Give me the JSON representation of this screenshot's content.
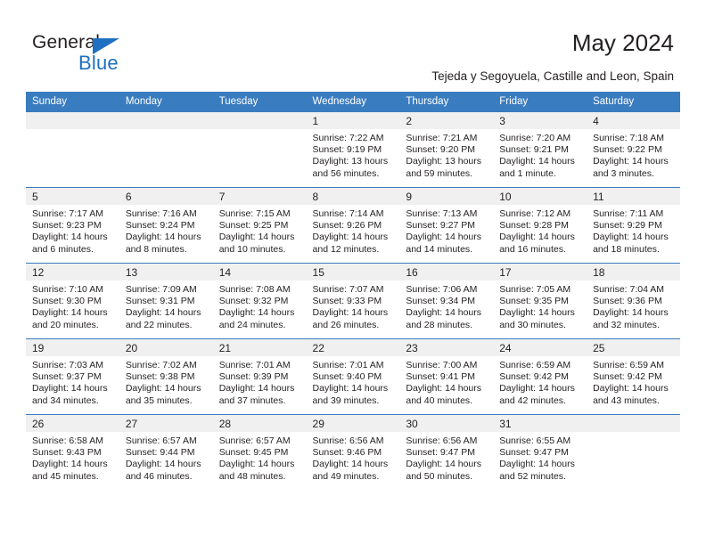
{
  "logo": {
    "word_one": "General",
    "word_two": "Blue",
    "triangle_color": "#1f70c1",
    "icon": "triangle-icon"
  },
  "header": {
    "title": "May 2024",
    "subtitle": "Tejeda y Segoyuela, Castille and Leon, Spain"
  },
  "colors": {
    "header_band": "#3a7cc0",
    "daynum_band": "#f0f0f0",
    "text": "#231f20",
    "brand_blue": "#1f70c1"
  },
  "calendar": {
    "weekday_headers": [
      "Sunday",
      "Monday",
      "Tuesday",
      "Wednesday",
      "Thursday",
      "Friday",
      "Saturday"
    ],
    "labels": {
      "sunrise": "Sunrise:",
      "sunset": "Sunset:",
      "daylight": "Daylight:"
    },
    "weeks": [
      [
        {
          "day": "",
          "empty": true
        },
        {
          "day": "",
          "empty": true
        },
        {
          "day": "",
          "empty": true
        },
        {
          "day": "1",
          "sunrise": "Sunrise: 7:22 AM",
          "sunset": "Sunset: 9:19 PM",
          "daylight": "Daylight: 13 hours and 56 minutes."
        },
        {
          "day": "2",
          "sunrise": "Sunrise: 7:21 AM",
          "sunset": "Sunset: 9:20 PM",
          "daylight": "Daylight: 13 hours and 59 minutes."
        },
        {
          "day": "3",
          "sunrise": "Sunrise: 7:20 AM",
          "sunset": "Sunset: 9:21 PM",
          "daylight": "Daylight: 14 hours and 1 minute."
        },
        {
          "day": "4",
          "sunrise": "Sunrise: 7:18 AM",
          "sunset": "Sunset: 9:22 PM",
          "daylight": "Daylight: 14 hours and 3 minutes."
        }
      ],
      [
        {
          "day": "5",
          "sunrise": "Sunrise: 7:17 AM",
          "sunset": "Sunset: 9:23 PM",
          "daylight": "Daylight: 14 hours and 6 minutes."
        },
        {
          "day": "6",
          "sunrise": "Sunrise: 7:16 AM",
          "sunset": "Sunset: 9:24 PM",
          "daylight": "Daylight: 14 hours and 8 minutes."
        },
        {
          "day": "7",
          "sunrise": "Sunrise: 7:15 AM",
          "sunset": "Sunset: 9:25 PM",
          "daylight": "Daylight: 14 hours and 10 minutes."
        },
        {
          "day": "8",
          "sunrise": "Sunrise: 7:14 AM",
          "sunset": "Sunset: 9:26 PM",
          "daylight": "Daylight: 14 hours and 12 minutes."
        },
        {
          "day": "9",
          "sunrise": "Sunrise: 7:13 AM",
          "sunset": "Sunset: 9:27 PM",
          "daylight": "Daylight: 14 hours and 14 minutes."
        },
        {
          "day": "10",
          "sunrise": "Sunrise: 7:12 AM",
          "sunset": "Sunset: 9:28 PM",
          "daylight": "Daylight: 14 hours and 16 minutes."
        },
        {
          "day": "11",
          "sunrise": "Sunrise: 7:11 AM",
          "sunset": "Sunset: 9:29 PM",
          "daylight": "Daylight: 14 hours and 18 minutes."
        }
      ],
      [
        {
          "day": "12",
          "sunrise": "Sunrise: 7:10 AM",
          "sunset": "Sunset: 9:30 PM",
          "daylight": "Daylight: 14 hours and 20 minutes."
        },
        {
          "day": "13",
          "sunrise": "Sunrise: 7:09 AM",
          "sunset": "Sunset: 9:31 PM",
          "daylight": "Daylight: 14 hours and 22 minutes."
        },
        {
          "day": "14",
          "sunrise": "Sunrise: 7:08 AM",
          "sunset": "Sunset: 9:32 PM",
          "daylight": "Daylight: 14 hours and 24 minutes."
        },
        {
          "day": "15",
          "sunrise": "Sunrise: 7:07 AM",
          "sunset": "Sunset: 9:33 PM",
          "daylight": "Daylight: 14 hours and 26 minutes."
        },
        {
          "day": "16",
          "sunrise": "Sunrise: 7:06 AM",
          "sunset": "Sunset: 9:34 PM",
          "daylight": "Daylight: 14 hours and 28 minutes."
        },
        {
          "day": "17",
          "sunrise": "Sunrise: 7:05 AM",
          "sunset": "Sunset: 9:35 PM",
          "daylight": "Daylight: 14 hours and 30 minutes."
        },
        {
          "day": "18",
          "sunrise": "Sunrise: 7:04 AM",
          "sunset": "Sunset: 9:36 PM",
          "daylight": "Daylight: 14 hours and 32 minutes."
        }
      ],
      [
        {
          "day": "19",
          "sunrise": "Sunrise: 7:03 AM",
          "sunset": "Sunset: 9:37 PM",
          "daylight": "Daylight: 14 hours and 34 minutes."
        },
        {
          "day": "20",
          "sunrise": "Sunrise: 7:02 AM",
          "sunset": "Sunset: 9:38 PM",
          "daylight": "Daylight: 14 hours and 35 minutes."
        },
        {
          "day": "21",
          "sunrise": "Sunrise: 7:01 AM",
          "sunset": "Sunset: 9:39 PM",
          "daylight": "Daylight: 14 hours and 37 minutes."
        },
        {
          "day": "22",
          "sunrise": "Sunrise: 7:01 AM",
          "sunset": "Sunset: 9:40 PM",
          "daylight": "Daylight: 14 hours and 39 minutes."
        },
        {
          "day": "23",
          "sunrise": "Sunrise: 7:00 AM",
          "sunset": "Sunset: 9:41 PM",
          "daylight": "Daylight: 14 hours and 40 minutes."
        },
        {
          "day": "24",
          "sunrise": "Sunrise: 6:59 AM",
          "sunset": "Sunset: 9:42 PM",
          "daylight": "Daylight: 14 hours and 42 minutes."
        },
        {
          "day": "25",
          "sunrise": "Sunrise: 6:59 AM",
          "sunset": "Sunset: 9:42 PM",
          "daylight": "Daylight: 14 hours and 43 minutes."
        }
      ],
      [
        {
          "day": "26",
          "sunrise": "Sunrise: 6:58 AM",
          "sunset": "Sunset: 9:43 PM",
          "daylight": "Daylight: 14 hours and 45 minutes."
        },
        {
          "day": "27",
          "sunrise": "Sunrise: 6:57 AM",
          "sunset": "Sunset: 9:44 PM",
          "daylight": "Daylight: 14 hours and 46 minutes."
        },
        {
          "day": "28",
          "sunrise": "Sunrise: 6:57 AM",
          "sunset": "Sunset: 9:45 PM",
          "daylight": "Daylight: 14 hours and 48 minutes."
        },
        {
          "day": "29",
          "sunrise": "Sunrise: 6:56 AM",
          "sunset": "Sunset: 9:46 PM",
          "daylight": "Daylight: 14 hours and 49 minutes."
        },
        {
          "day": "30",
          "sunrise": "Sunrise: 6:56 AM",
          "sunset": "Sunset: 9:47 PM",
          "daylight": "Daylight: 14 hours and 50 minutes."
        },
        {
          "day": "31",
          "sunrise": "Sunrise: 6:55 AM",
          "sunset": "Sunset: 9:47 PM",
          "daylight": "Daylight: 14 hours and 52 minutes."
        },
        {
          "day": "",
          "empty": true
        }
      ]
    ]
  }
}
